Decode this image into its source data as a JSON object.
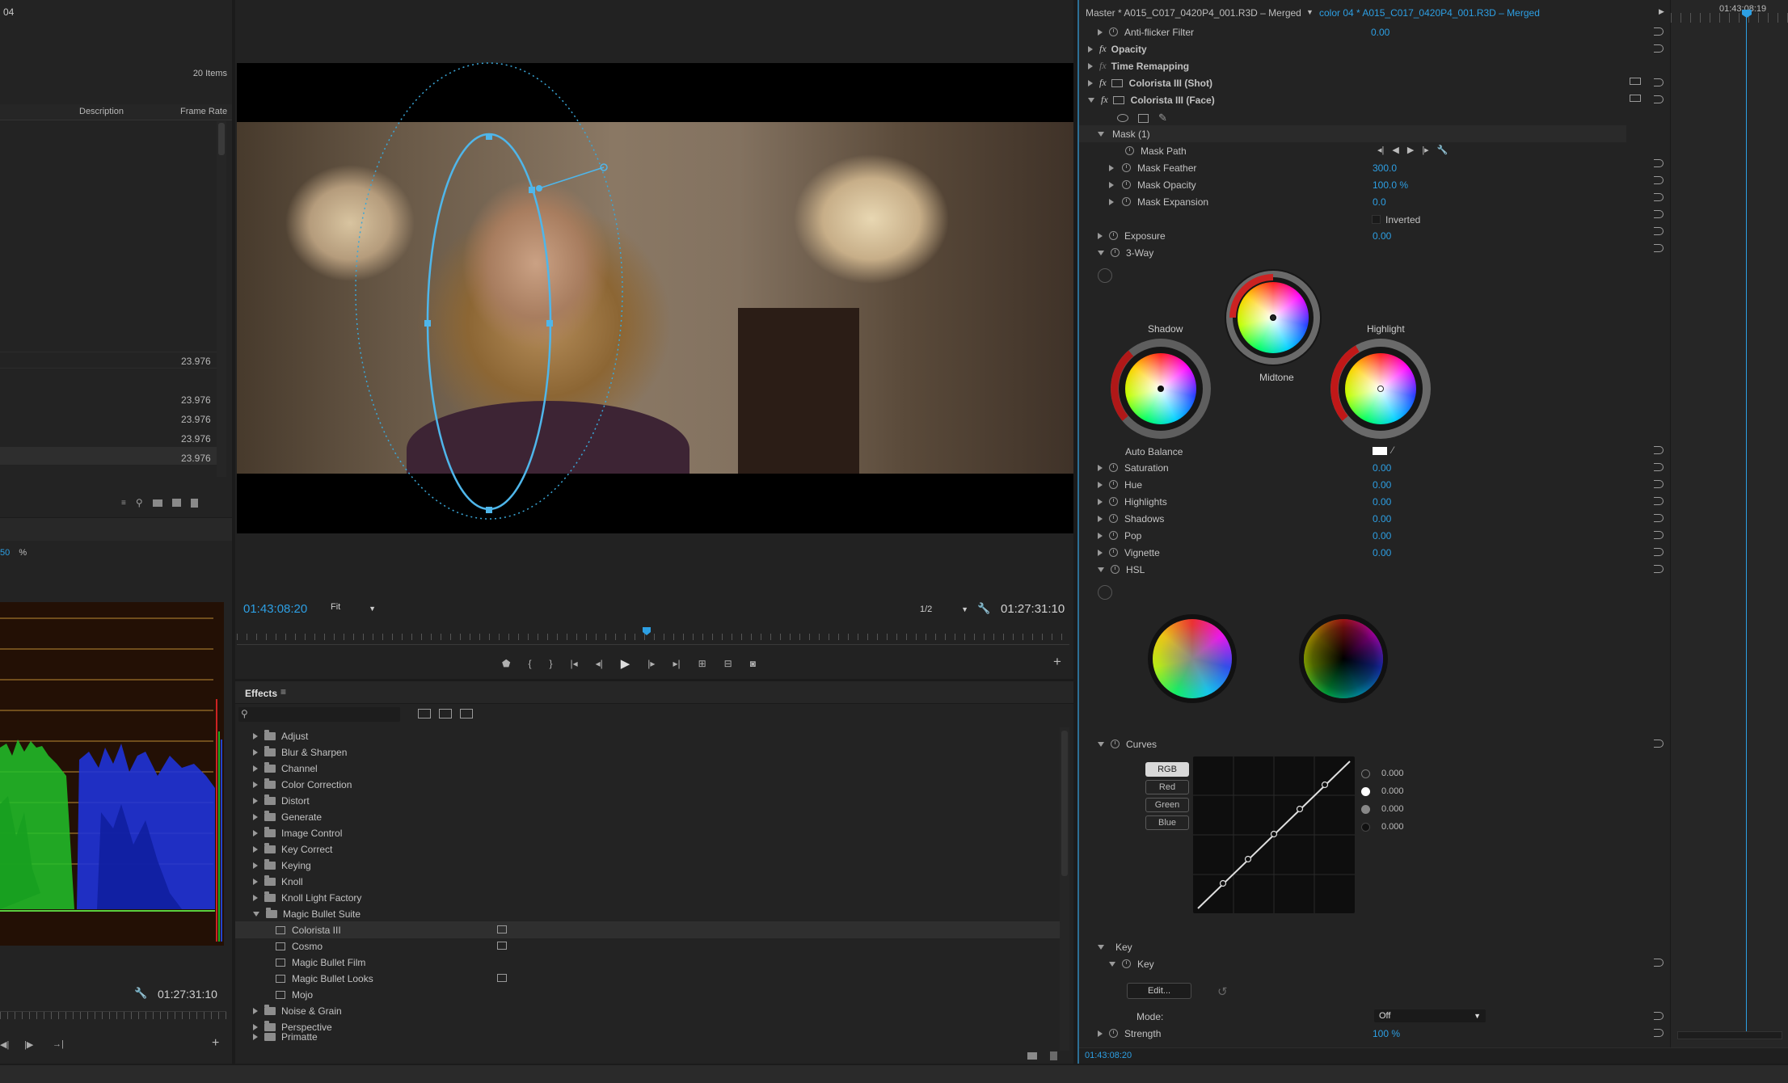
{
  "project": {
    "title_fragment": "04",
    "items_count": "20 Items",
    "col_description": "Description",
    "col_framerate": "Frame Rate",
    "rates": [
      "23.976",
      "23.976",
      "23.976",
      "23.976",
      "23.976"
    ]
  },
  "scope": {
    "zoom_value": "50",
    "zoom_unit": "%",
    "timecode": "01:27:31:10"
  },
  "program": {
    "timecode_left": "01:43:08:20",
    "fit_label": "Fit",
    "resolution": "1/2",
    "timecode_right": "01:27:31:10"
  },
  "effects": {
    "tab_label": "Effects",
    "search_placeholder": "",
    "folders": [
      "Adjust",
      "Blur & Sharpen",
      "Channel",
      "Color Correction",
      "Distort",
      "Generate",
      "Image Control",
      "Key Correct",
      "Keying",
      "Knoll",
      "Knoll Light Factory",
      "Magic Bullet Suite"
    ],
    "subitems": [
      "Colorista III",
      "Cosmo",
      "Magic Bullet Film",
      "Magic Bullet Looks",
      "Mojo"
    ],
    "folders_after": [
      "Noise & Grain",
      "Perspective",
      "Primatte"
    ]
  },
  "ec": {
    "header_master": "Master * A015_C017_0420P4_001.R3D – Merged",
    "header_clip": "color 04 * A015_C017_0420P4_001.R3D – Merged",
    "timeline_tc": "01:43:08:19",
    "anti_flicker": "Anti-flicker Filter",
    "anti_flicker_val": "0.00",
    "opacity": "Opacity",
    "time_remap": "Time Remapping",
    "colorista_shot": "Colorista III (Shot)",
    "colorista_face": "Colorista III (Face)",
    "mask": "Mask (1)",
    "mask_path": "Mask Path",
    "mask_feather": "Mask Feather",
    "mask_feather_val": "300.0",
    "mask_opacity": "Mask Opacity",
    "mask_opacity_val": "100.0 %",
    "mask_expansion": "Mask Expansion",
    "mask_expansion_val": "0.0",
    "inverted": "Inverted",
    "exposure": "Exposure",
    "exposure_val": "0.00",
    "three_way": "3-Way",
    "shadow": "Shadow",
    "midtone": "Midtone",
    "highlight": "Highlight",
    "auto_balance": "Auto Balance",
    "saturation": "Saturation",
    "saturation_val": "0.00",
    "hue": "Hue",
    "hue_val": "0.00",
    "highlights": "Highlights",
    "highlights_val": "0.00",
    "shadows": "Shadows",
    "shadows_val": "0.00",
    "pop": "Pop",
    "pop_val": "0.00",
    "vignette": "Vignette",
    "vignette_val": "0.00",
    "hsl": "HSL",
    "curves": "Curves",
    "curve_btns": [
      "RGB",
      "Red",
      "Green",
      "Blue"
    ],
    "curve_vals": [
      "0.000",
      "0.000",
      "0.000",
      "0.000"
    ],
    "key_group": "Key",
    "key": "Key",
    "edit_btn": "Edit...",
    "mode_label": "Mode:",
    "mode_value": "Off",
    "strength": "Strength",
    "strength_val": "100 %",
    "footer_tc": "01:43:08:20"
  },
  "colors": {
    "accent": "#2d9fe3",
    "panel": "#232323",
    "bg": "#1b1b1b"
  }
}
